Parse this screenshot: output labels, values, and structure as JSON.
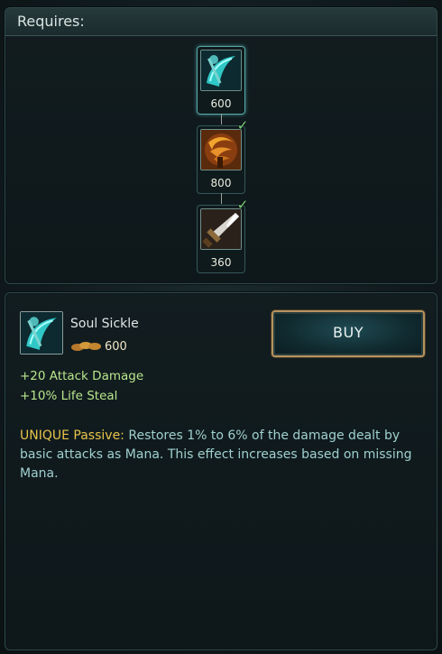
{
  "requires": {
    "title": "Requires:",
    "nodes": [
      {
        "name": "Soul Sickle",
        "icon": "soul-sickle-icon",
        "price": "600",
        "owned": false
      },
      {
        "name": "Claw",
        "icon": "claw-icon",
        "price": "800",
        "owned": true
      },
      {
        "name": "Dagger",
        "icon": "dagger-icon",
        "price": "360",
        "owned": true
      }
    ]
  },
  "item": {
    "name": "Soul Sickle",
    "icon": "soul-sickle-icon",
    "price": "600",
    "buy_label": "BUY",
    "stats": [
      "+20 Attack Damage",
      "+10% Life Steal"
    ],
    "passive_label": "UNIQUE Passive:",
    "passive_text": " Restores 1% to 6% of the damage dealt by basic attacks as Mana. This effect increases based on missing Mana."
  },
  "colors": {
    "stat_text": "#b9e68c",
    "unique_label": "#e8c34b",
    "description_text": "#9fd0cf",
    "check": "#7fd27a",
    "buy_border": "#b5935f"
  }
}
